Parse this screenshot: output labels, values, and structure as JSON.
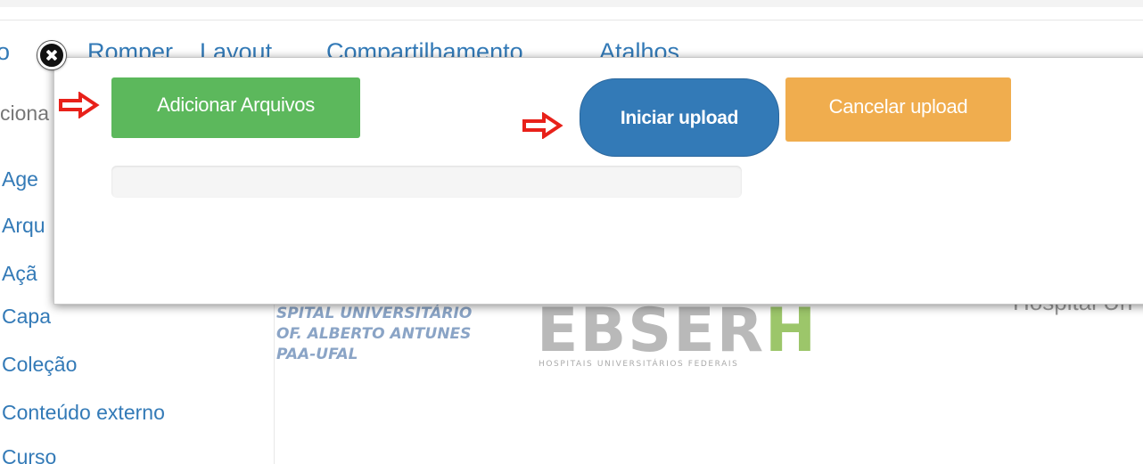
{
  "background": {
    "menu": [
      "o",
      "Romper",
      "Layout",
      "Compartilhamento",
      "Atalhos"
    ],
    "sidebar_category": "ciona",
    "sidebar_items": [
      "Age",
      "Arqu",
      "Açã",
      "Capa",
      "Coleção",
      "Conteúdo externo",
      "Curso"
    ],
    "logo_huf_lines": [
      "SPITAL UNIVERSITÁRIO",
      "OF. ALBERTO ANTUNES",
      "PAA-UFAL"
    ],
    "logo_ebserh": {
      "main": "EBSER",
      "accent": "H",
      "subtitle": "HOSPITAIS UNIVERSITÁRIOS FEDERAIS"
    },
    "right_text": "Hospital Un"
  },
  "modal": {
    "add_files_label": "Adicionar Arquivos",
    "start_upload_label": "Iniciar upload",
    "cancel_upload_label": "Cancelar upload",
    "progress": 0
  },
  "icons": {
    "close": "close-icon",
    "annotation_arrow": "arrow-right-icon"
  },
  "colors": {
    "success": "#5cb85c",
    "primary": "#337ab7",
    "warning": "#f0ad4e",
    "annotation": "#e8211a"
  }
}
